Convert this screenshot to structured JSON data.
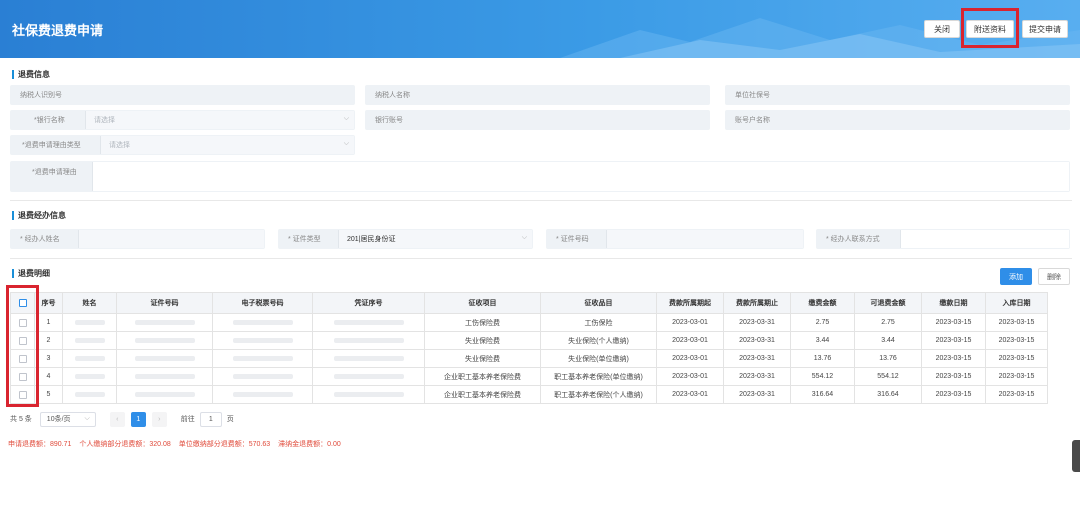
{
  "header": {
    "title": "社保费退费申请",
    "buttons": {
      "close": "关闭",
      "attach": "附送资料",
      "submit": "提交申请"
    }
  },
  "refund_info": {
    "section_title": "退费信息",
    "taxpayer_id_label": "纳税人识别号",
    "taxpayer_name_label": "纳税人名称",
    "unit_ss_no_label": "单位社保号",
    "bank_name_label": "*银行名称",
    "bank_name_placeholder": "请选择",
    "bank_account_label": "银行账号",
    "account_holder_label": "账号户名称",
    "reason_type_label": "*退费申请理由类型",
    "reason_type_placeholder": "请选择",
    "reason_label": "*退费申请理由"
  },
  "handler_info": {
    "section_title": "退费经办信息",
    "name_label": "* 经办人姓名",
    "id_type_label": "* 证件类型",
    "id_type_value": "201|居民身份证",
    "id_no_label": "* 证件号码",
    "contact_label": "* 经办人联系方式"
  },
  "detail": {
    "section_title": "退费明细",
    "add_label": "添加",
    "delete_label": "删除",
    "columns": [
      "序号",
      "姓名",
      "证件号码",
      "电子税票号码",
      "凭证序号",
      "征收项目",
      "征收品目",
      "费款所属期起",
      "费款所属期止",
      "缴费金额",
      "可退费金额",
      "缴款日期",
      "入库日期"
    ],
    "rows": [
      {
        "no": "1",
        "item": "工伤保险费",
        "sub_item": "工伤保险",
        "start": "2023-03-01",
        "end": "2023-03-31",
        "amount": "2.75",
        "refundable": "2.75",
        "pay_date": "2023-03-15",
        "store_date": "2023-03-15"
      },
      {
        "no": "2",
        "item": "失业保险费",
        "sub_item": "失业保险(个人缴纳)",
        "start": "2023-03-01",
        "end": "2023-03-31",
        "amount": "3.44",
        "refundable": "3.44",
        "pay_date": "2023-03-15",
        "store_date": "2023-03-15"
      },
      {
        "no": "3",
        "item": "失业保险费",
        "sub_item": "失业保险(单位缴纳)",
        "start": "2023-03-01",
        "end": "2023-03-31",
        "amount": "13.76",
        "refundable": "13.76",
        "pay_date": "2023-03-15",
        "store_date": "2023-03-15"
      },
      {
        "no": "4",
        "item": "企业职工基本养老保险费",
        "sub_item": "职工基本养老保险(单位缴纳)",
        "start": "2023-03-01",
        "end": "2023-03-31",
        "amount": "554.12",
        "refundable": "554.12",
        "pay_date": "2023-03-15",
        "store_date": "2023-03-15"
      },
      {
        "no": "5",
        "item": "企业职工基本养老保险费",
        "sub_item": "职工基本养老保险(个人缴纳)",
        "start": "2023-03-01",
        "end": "2023-03-31",
        "amount": "316.64",
        "refundable": "316.64",
        "pay_date": "2023-03-15",
        "store_date": "2023-03-15"
      }
    ]
  },
  "pagination": {
    "total": "共 5 条",
    "page_size": "10条/页",
    "prev": "‹",
    "current": "1",
    "next": "›",
    "goto_label": "前往",
    "goto_value": "1",
    "page_suffix": "页"
  },
  "summary": {
    "total": "申请退费额：890.71",
    "personal": "个人缴纳部分退费额：320.08",
    "unit": "单位缴纳部分退费额：570.63",
    "late_fee": "滞纳金退费额：0.00"
  },
  "colors": {
    "accent": "#2f8ee8",
    "highlight": "#d9242f",
    "summary": "#e04a3a"
  }
}
